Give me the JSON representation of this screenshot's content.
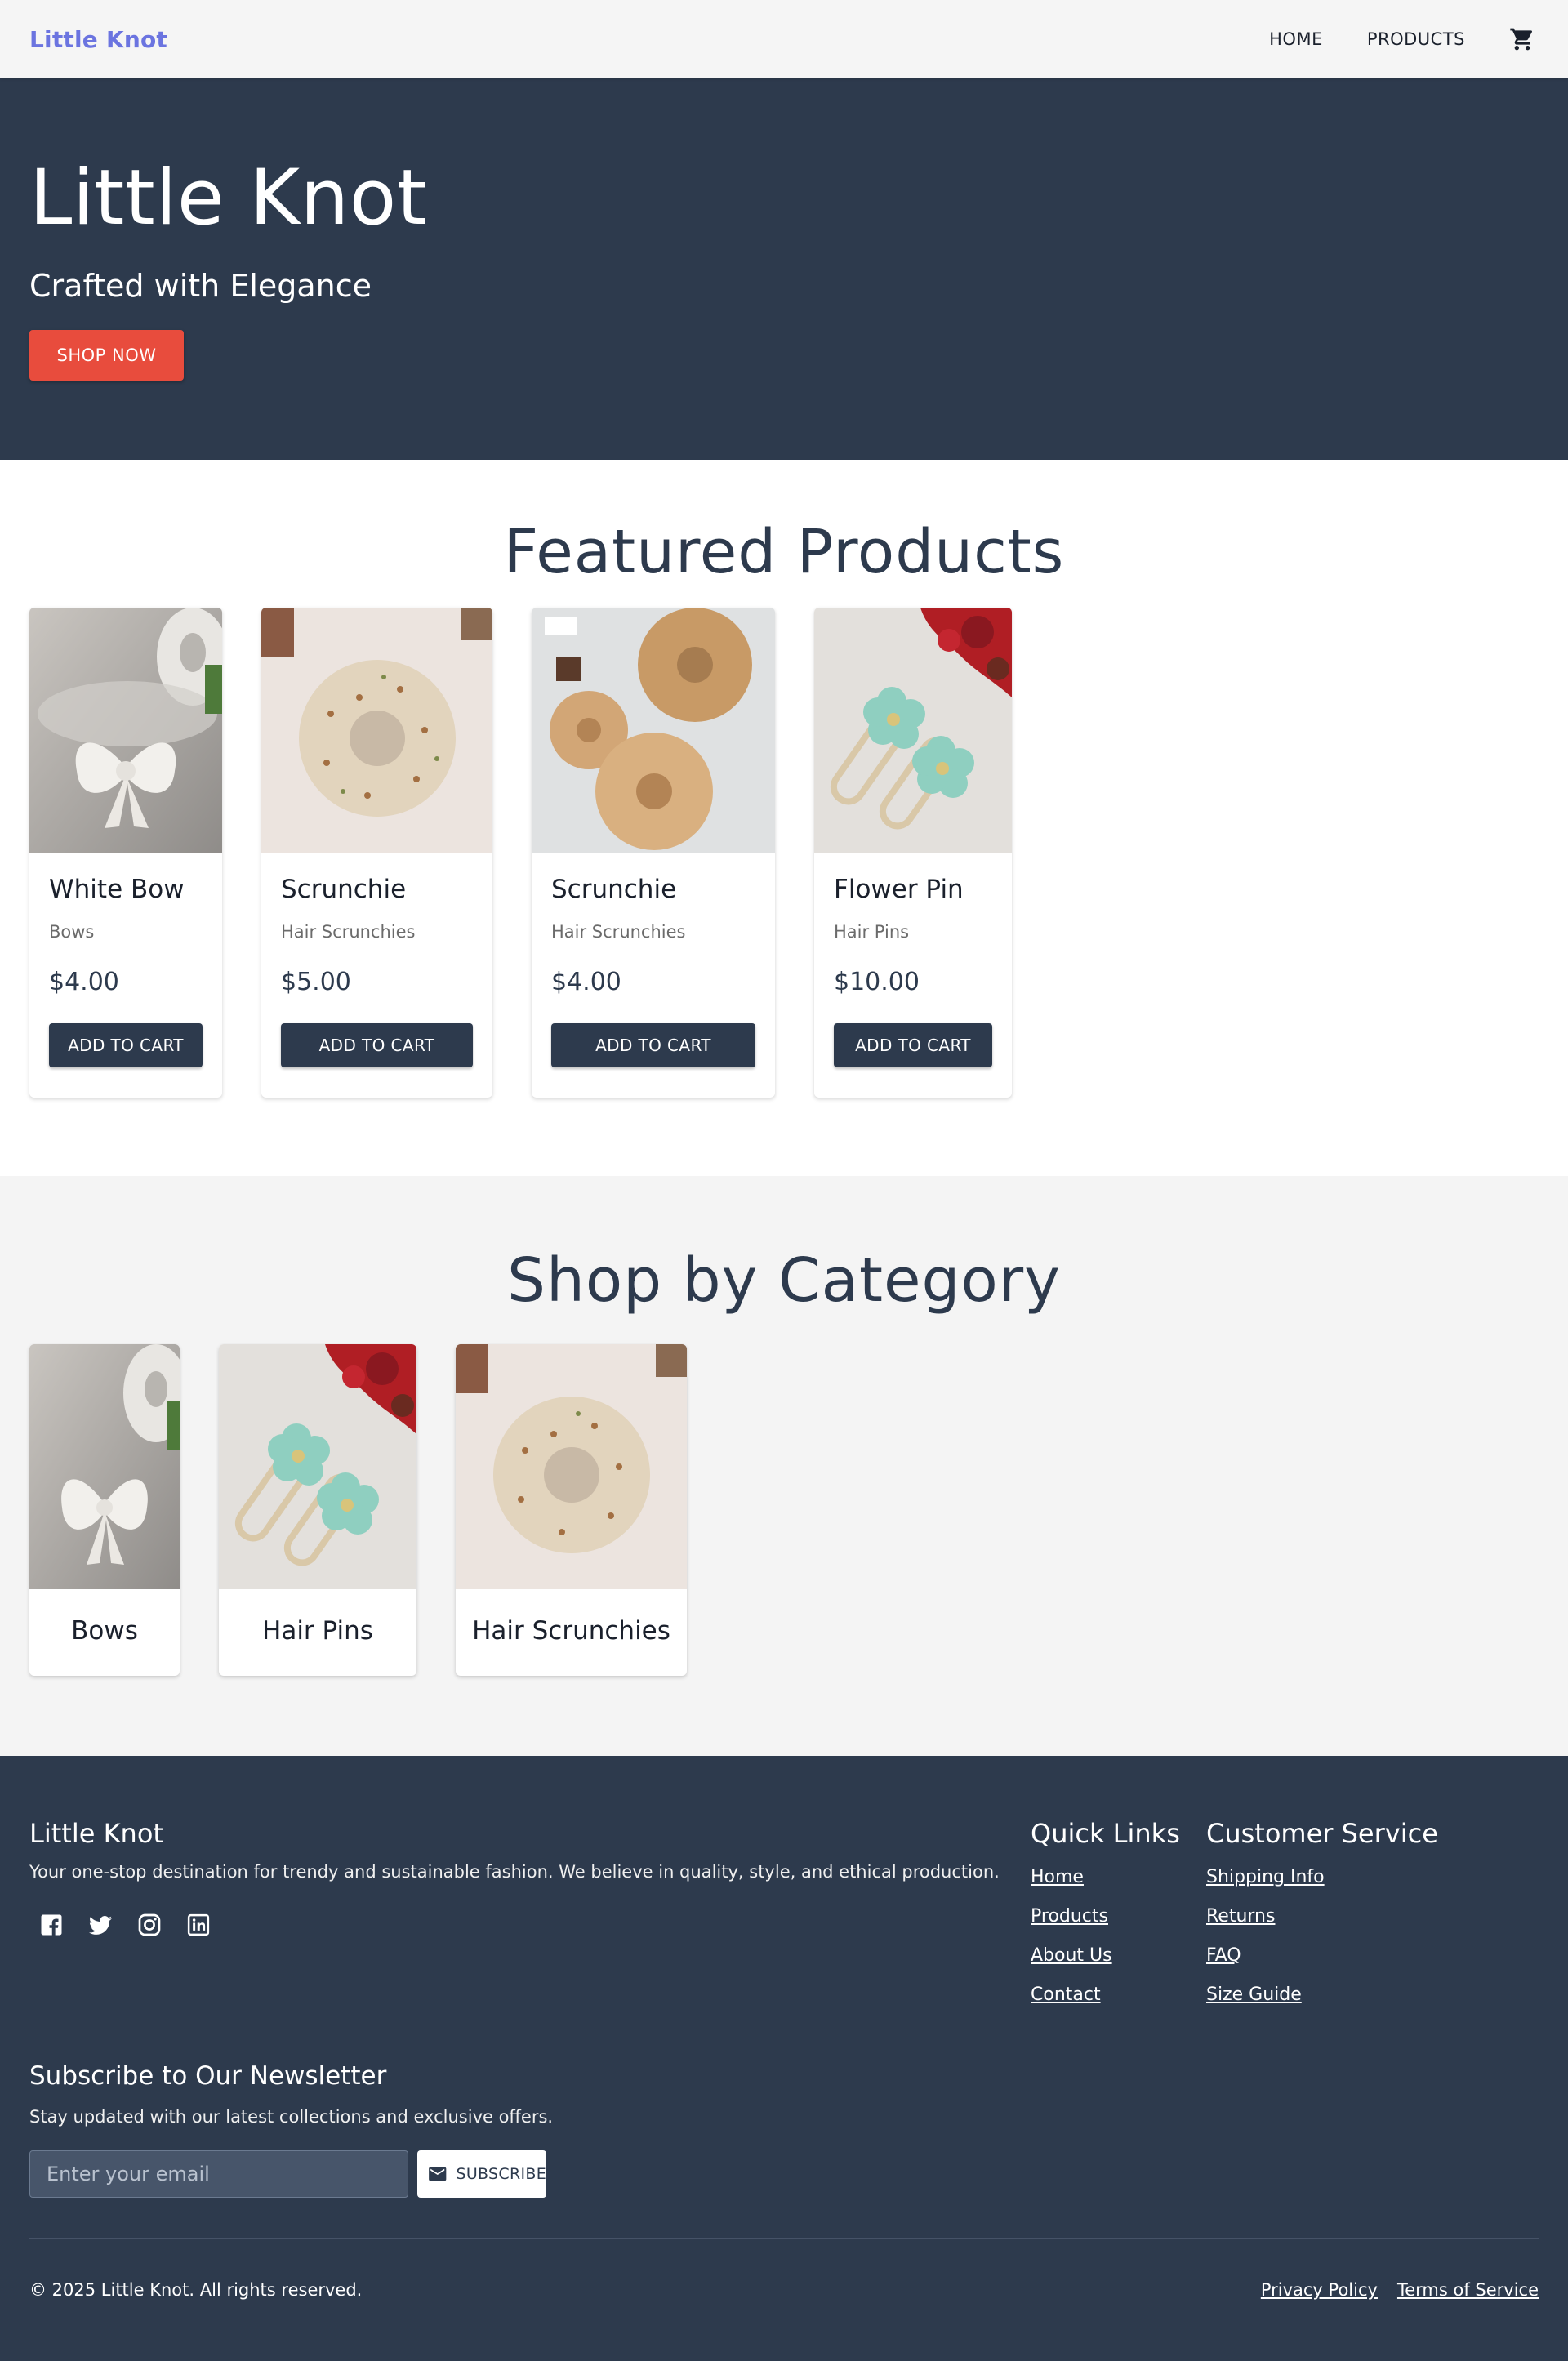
{
  "nav": {
    "brand": "Little Knot",
    "links": [
      "HOME",
      "PRODUCTS"
    ],
    "cart_icon": "shopping-cart-icon"
  },
  "hero": {
    "title": "Little Knot",
    "subtitle": "Crafted with Elegance",
    "cta": "SHOP NOW"
  },
  "featured": {
    "title": "Featured Products",
    "products": [
      {
        "name": "White Bow",
        "category": "Bows",
        "price": "$4.00",
        "button": "ADD TO CART"
      },
      {
        "name": "Scrunchie",
        "category": "Hair Scrunchies",
        "price": "$5.00",
        "button": "ADD TO CART"
      },
      {
        "name": "Scrunchie",
        "category": "Hair Scrunchies",
        "price": "$4.00",
        "button": "ADD TO CART"
      },
      {
        "name": "Flower Pin",
        "category": "Hair Pins",
        "price": "$10.00",
        "button": "ADD TO CART"
      }
    ]
  },
  "categories": {
    "title": "Shop by Category",
    "items": [
      "Bows",
      "Hair Pins",
      "Hair Scrunchies"
    ]
  },
  "footer": {
    "brand": "Little Knot",
    "description": "Your one-stop destination for trendy and sustainable fashion. We believe in quality, style, and ethical production.",
    "socials": [
      "facebook-icon",
      "twitter-icon",
      "instagram-icon",
      "linkedin-icon"
    ],
    "quick_links": {
      "title": "Quick Links",
      "links": [
        "Home",
        "Products",
        "About Us",
        "Contact"
      ]
    },
    "customer_service": {
      "title": "Customer Service",
      "links": [
        "Shipping Info",
        "Returns",
        "FAQ",
        "Size Guide"
      ]
    },
    "newsletter": {
      "title": "Subscribe to Our Newsletter",
      "subtitle": "Stay updated with our latest collections and exclusive offers.",
      "placeholder": "Enter your email",
      "button": "SUBSCRIBE"
    },
    "copyright": "© 2025 Little Knot. All rights reserved.",
    "legal": [
      "Privacy Policy",
      "Terms of Service"
    ]
  },
  "colors": {
    "brand": "#6b74e0",
    "dark": "#2d3a4d",
    "accent": "#e84c3d"
  }
}
